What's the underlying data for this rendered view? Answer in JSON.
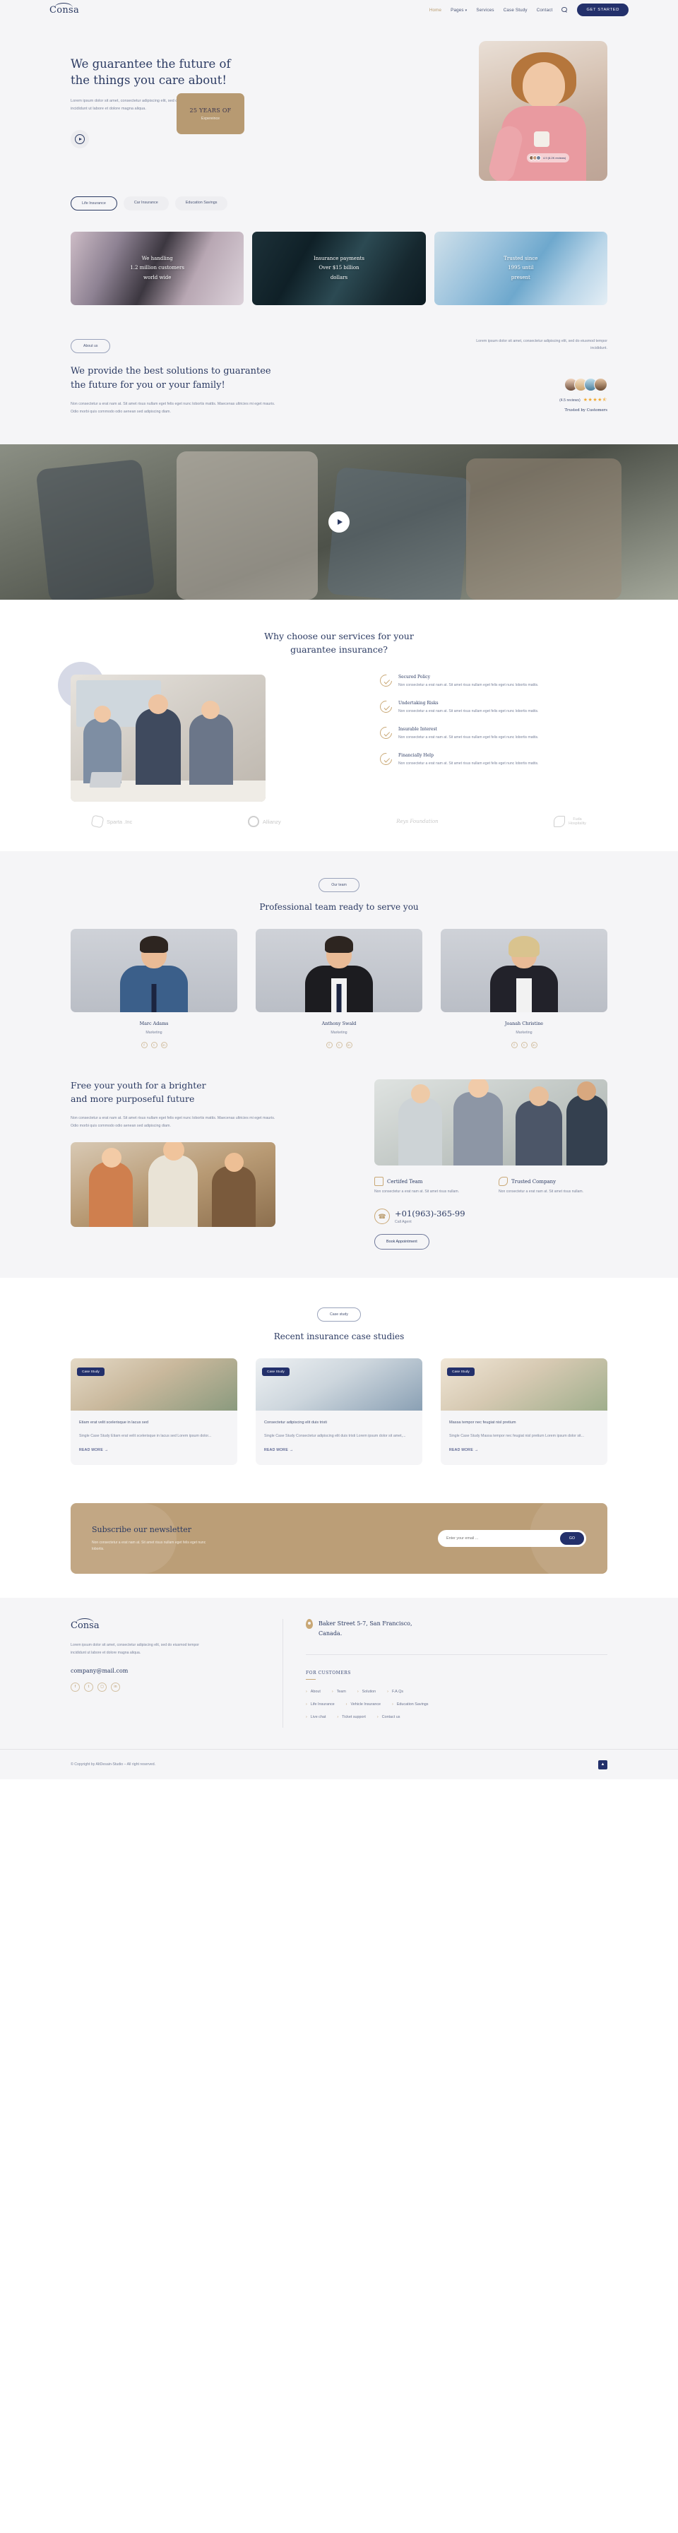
{
  "brand": {
    "name": "Consa"
  },
  "header": {
    "nav": [
      {
        "label": "Home",
        "active": true
      },
      {
        "label": "Pages",
        "caret": "⌄",
        "active": false
      },
      {
        "label": "Services",
        "active": false
      },
      {
        "label": "Case Study",
        "active": false
      },
      {
        "label": "Contact",
        "active": false
      }
    ],
    "search_icon": "search-icon",
    "cta": "GET STARTED"
  },
  "hero": {
    "title_line1": "We guarantee the future of",
    "title_line2": "the things you care about!",
    "subtitle": "Lorem ipsum dolor sit amet, consectetur adipiscing elit, sed do eiusmod tempor incididunt ut labore et dolore magna aliqua.",
    "play_icon": "play-icon",
    "badge_text": "4.9 (8.2K reviews)",
    "pills": [
      {
        "label": "Life Insurance",
        "active": true
      },
      {
        "label": "Car Insurance",
        "active": false
      },
      {
        "label": "Education Savings",
        "active": false
      }
    ],
    "stats": [
      {
        "line1": "We handling",
        "line2": "1.2 million customers",
        "line3": "world wide"
      },
      {
        "line1": "Insurance payments",
        "line2": "Over $15 billion",
        "line3": "dollars"
      },
      {
        "line1": "Trusted since",
        "line2": "1995 until",
        "line3": "present"
      }
    ]
  },
  "about": {
    "tag": "About us",
    "title_line1": "We provide the best solutions to guarantee",
    "title_line2": "the future for you or your family!",
    "body": "Non consectetur a erat nam at. Sit amet risus nullam eget felis eget nunc lobortis mattis. Maecenas ultricies mi eget mauris. Odio morbi quis commodo odio aenean sed adipiscing diam.",
    "lead": "Lorem ipsum dolor sit amet, consectetur adipiscing elit, sed do eiusmod tempor incididunt.",
    "reviews": "(4.5 reviews)",
    "stars": "★★★★⯪",
    "trusted": "Trusted by Customers"
  },
  "banner": {
    "play_icon": "play-icon"
  },
  "why": {
    "title_line1": "Why choose our services for your",
    "title_line2": "guarantee insurance?",
    "features": [
      {
        "title": "Secured Policy",
        "desc": "Non consectetur a erat nam at. Sit amet risus nullam eget felis eget nunc lobortis mattis."
      },
      {
        "title": "Undertaking Risks",
        "desc": "Non consectetur a erat nam at. Sit amet risus nullam eget felis eget nunc lobortis mattis."
      },
      {
        "title": "Insurable Interest",
        "desc": "Non consectetur a erat nam at. Sit amet risus nullam eget felis eget nunc lobortis mattis."
      },
      {
        "title": "Financially Help",
        "desc": "Non consectetur a erat nam at. Sit amet risus nullam eget felis eget nunc lobortis mattis."
      }
    ]
  },
  "logos": [
    {
      "name": "Sparta .Inc"
    },
    {
      "name": "Allianzy"
    },
    {
      "name": "Reys Foundation"
    },
    {
      "name_line1": "Fuda",
      "name_line2": "Hospitality"
    }
  ],
  "team": {
    "tag": "Our team",
    "title": "Professional team ready to serve you",
    "members": [
      {
        "name": "Marc Adams",
        "role": "Marketing",
        "socials": [
          "f",
          "t",
          "in"
        ]
      },
      {
        "name": "Anthony Swald",
        "role": "Marketing",
        "socials": [
          "f",
          "t",
          "in"
        ]
      },
      {
        "name": "Joanah Christine",
        "role": "Marketing",
        "socials": [
          "f",
          "t",
          "in"
        ]
      }
    ]
  },
  "youth": {
    "title_line1": "Free your youth for a brighter",
    "title_line2": "and more purposeful future",
    "body": "Non consectetur a erat nam at. Sit amet risus nullam eget felis eget nunc lobortis mattis. Maecenas ultricies mi eget mauris. Odio morbi quis commodo odio aenean sed adipiscing diam.",
    "badge_number": "25 YEARS OF",
    "badge_label": "Expereince",
    "cards": [
      {
        "title": "Certifed Team",
        "desc": "Non consectetur a erat nam at. Sit amet risus nullam.",
        "icon": "certificate-icon"
      },
      {
        "title": "Trusted Company",
        "desc": "Non consectetur a erat nam at. Sit amet risus nullam.",
        "icon": "handshake-icon"
      }
    ],
    "phone": "+01(963)-365-99",
    "phone_caption": "Call Agent",
    "phone_icon": "phone-icon",
    "book_button": "Book Appointment"
  },
  "cases": {
    "tag": "Case study",
    "title": "Recent insurance case studies",
    "items": [
      {
        "tag": "Case Study",
        "heading": "Etiam erat velit scelerisque in lacus sed",
        "excerpt": "Single Case Study Etiam erat velit scelerisque in lacus sed Lorem ipsum dolor...",
        "more": "READ MORE →"
      },
      {
        "tag": "Case Study",
        "heading": "Consectetur adipiscing elit duis tristi",
        "excerpt": "Single Case Study Consectetur adipiscing elit duis tristi Lorem ipsum dolor sit amet,...",
        "more": "READ MORE →"
      },
      {
        "tag": "Case Study",
        "heading": "Massa tempor nec feugiat nisl pretium",
        "excerpt": "Single Case Study Massa tempor nec feugiat nisl pretium Lorem ipsum dolor sit...",
        "more": "READ MORE →"
      }
    ]
  },
  "newsletter": {
    "title": "Subscribe our newsletter",
    "body": "Non consectetur a erat nam at. Sit amet risus nullam eget felis eget nunc lobortis.",
    "placeholder": "Enter your email ...",
    "button": "GO"
  },
  "footer": {
    "brand": "Consa",
    "desc": "Lorem ipsum dolor sit amet, consectetur adipiscing elit, sed do eiusmod tempor incididunt ut labore et dolore magna aliqua.",
    "email": "company@mail.com",
    "socials": [
      "f",
      "t",
      "ig",
      "in"
    ],
    "address_line1": "Baker Street 5-7, San Francisco,",
    "address_line2": "Canada.",
    "links_heading": "FOR CUSTOMERS",
    "link_rows": [
      [
        "About",
        "Team",
        "Solution",
        "F.A.Qs"
      ],
      [
        "Life Insurance",
        "Vehicle Insurance",
        "Education Savings"
      ],
      [
        "Live chat",
        "Ticket support",
        "Contact us"
      ]
    ],
    "copyright": "© Copyright by AltDesain-Studio – All right reserved.",
    "top_icon": "arrow-up-icon"
  },
  "colors": {
    "navy": "#23306b",
    "gold": "#b99a6b",
    "bg": "#f5f5f7"
  }
}
